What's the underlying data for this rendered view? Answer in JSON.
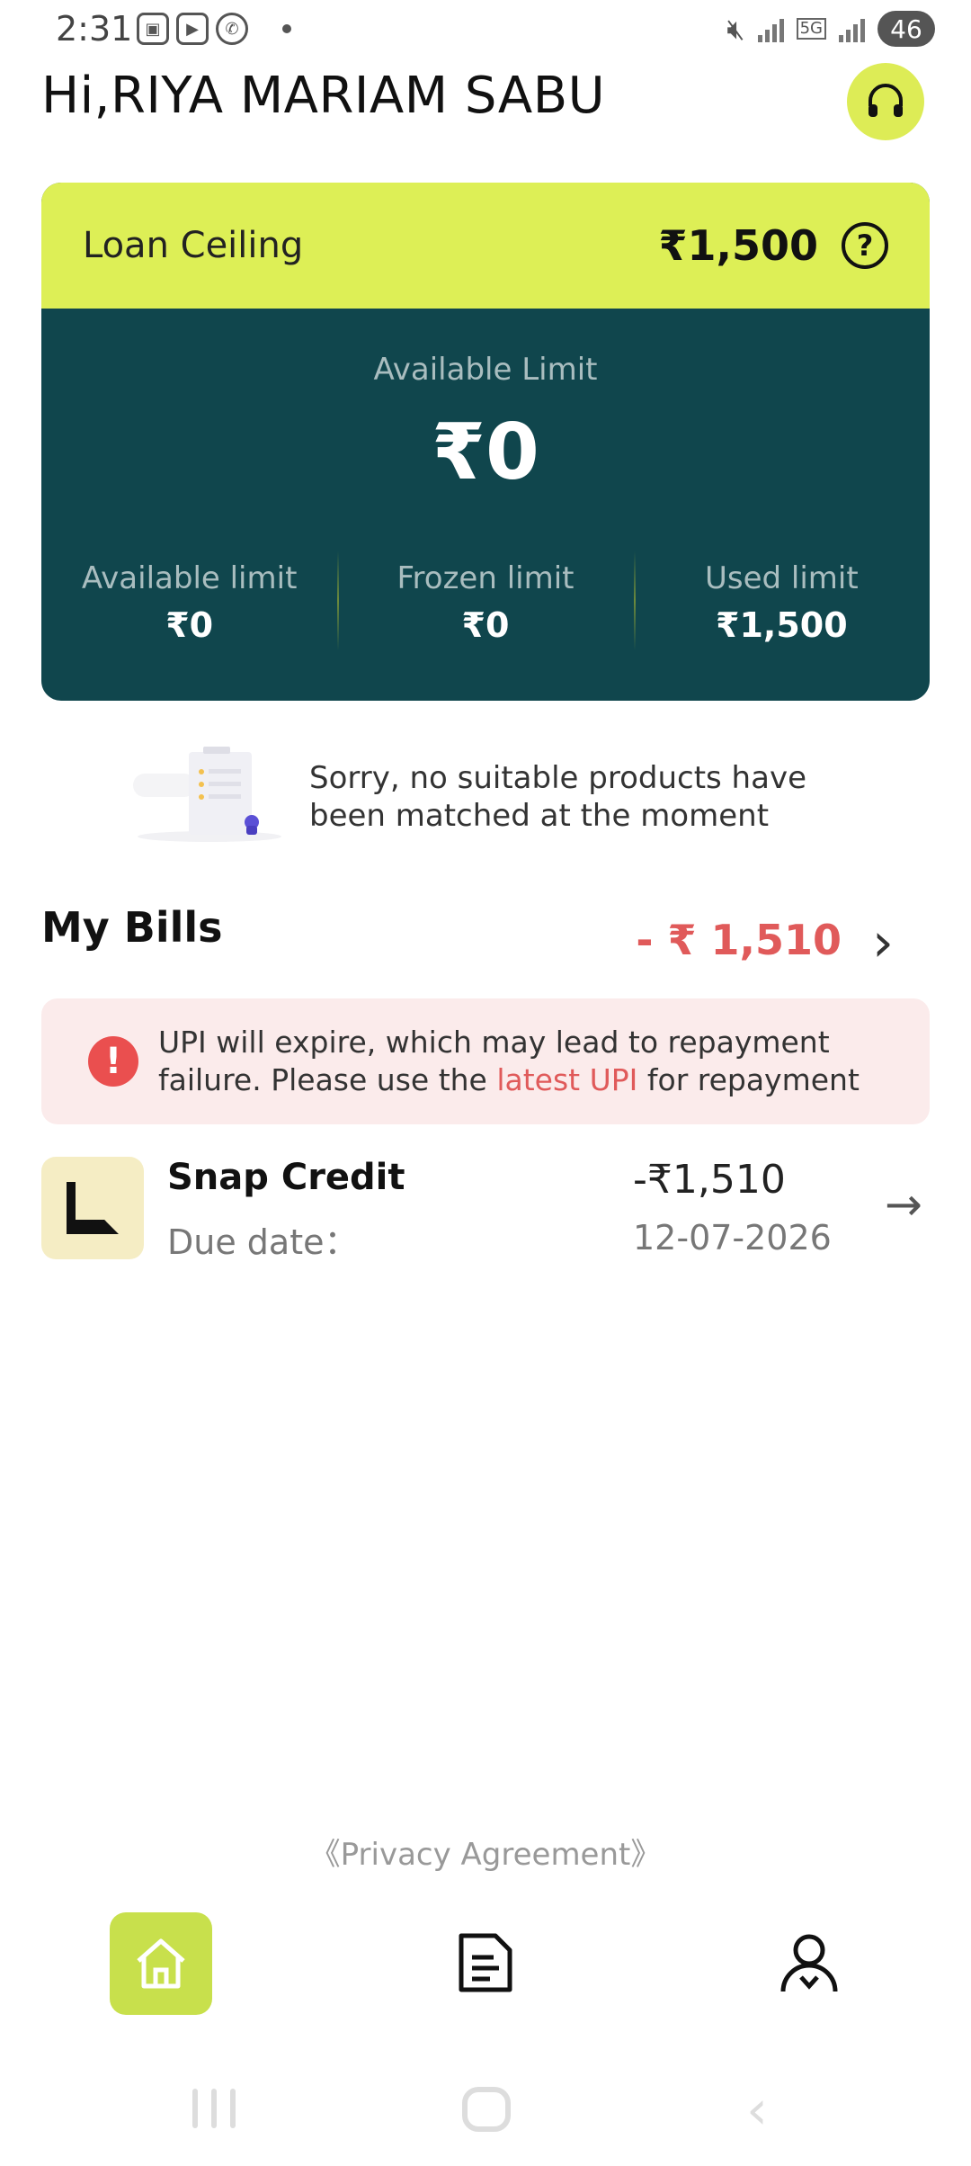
{
  "status_bar": {
    "time": "2:31",
    "net_type": "5G",
    "battery": "46"
  },
  "header": {
    "greeting": "Hi,RIYA MARIAM SABU"
  },
  "loan_card": {
    "ceiling_label": "Loan Ceiling",
    "ceiling_value": "₹1,500",
    "available_label": "Available Limit",
    "available_value": "₹0",
    "limits": [
      {
        "label": "Available limit",
        "value": "₹0"
      },
      {
        "label": "Frozen limit",
        "value": "₹0"
      },
      {
        "label": "Used limit",
        "value": "₹1,500"
      }
    ],
    "colors": {
      "accent": "#ddef56",
      "card_bg": "#10464d"
    }
  },
  "empty_products": {
    "message": "Sorry, no suitable products have been matched at the moment"
  },
  "bills": {
    "title": "My Bills",
    "total": "- ₹ 1,510",
    "warning_text_1": "UPI will expire, which may lead to repayment failure. Please use the ",
    "warning_link": "latest UPI",
    "warning_text_2": " for repayment",
    "items": [
      {
        "name": "Snap Credit",
        "due_label": "Due date：",
        "amount": "-₹1,510",
        "due_date": "12-07-2026"
      }
    ]
  },
  "footer": {
    "privacy": "《Privacy Agreement》"
  },
  "nav": {
    "items": [
      "home-icon",
      "bills-icon",
      "profile-icon"
    ]
  }
}
